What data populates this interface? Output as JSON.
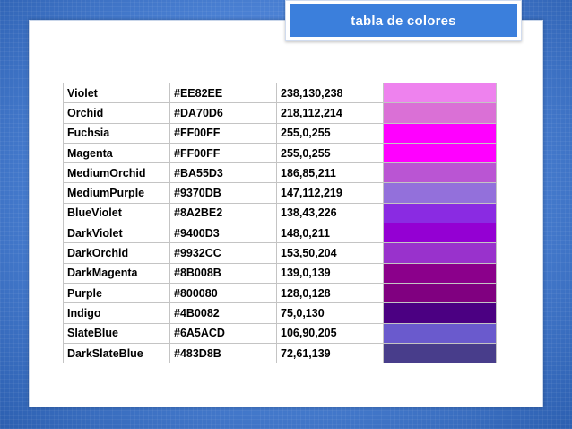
{
  "slide": {
    "title": "tabla de colores"
  },
  "table": {
    "rows": [
      {
        "name": "Violet",
        "hex": "#EE82EE",
        "rgb": "238,130,238",
        "color": "#EE82EE"
      },
      {
        "name": "Orchid",
        "hex": "#DA70D6",
        "rgb": "218,112,214",
        "color": "#DA70D6"
      },
      {
        "name": "Fuchsia",
        "hex": "#FF00FF",
        "rgb": "255,0,255",
        "color": "#FF00FF"
      },
      {
        "name": "Magenta",
        "hex": "#FF00FF",
        "rgb": "255,0,255",
        "color": "#FF00FF"
      },
      {
        "name": "MediumOrchid",
        "hex": "#BA55D3",
        "rgb": "186,85,211",
        "color": "#BA55D3"
      },
      {
        "name": "MediumPurple",
        "hex": "#9370DB",
        "rgb": "147,112,219",
        "color": "#9370DB"
      },
      {
        "name": "BlueViolet",
        "hex": "#8A2BE2",
        "rgb": "138,43,226",
        "color": "#8A2BE2"
      },
      {
        "name": "DarkViolet",
        "hex": "#9400D3",
        "rgb": "148,0,211",
        "color": "#9400D3"
      },
      {
        "name": "DarkOrchid",
        "hex": "#9932CC",
        "rgb": "153,50,204",
        "color": "#9932CC"
      },
      {
        "name": "DarkMagenta",
        "hex": "#8B008B",
        "rgb": "139,0,139",
        "color": "#8B008B"
      },
      {
        "name": "Purple",
        "hex": "#800080",
        "rgb": "128,0,128",
        "color": "#800080"
      },
      {
        "name": "Indigo",
        "hex": "#4B0082",
        "rgb": "75,0,130",
        "color": "#4B0082"
      },
      {
        "name": "SlateBlue",
        "hex": "#6A5ACD",
        "rgb": "106,90,205",
        "color": "#6A5ACD"
      },
      {
        "name": "DarkSlateBlue",
        "hex": "#483D8B",
        "rgb": "72,61,139",
        "color": "#483D8B"
      }
    ]
  }
}
